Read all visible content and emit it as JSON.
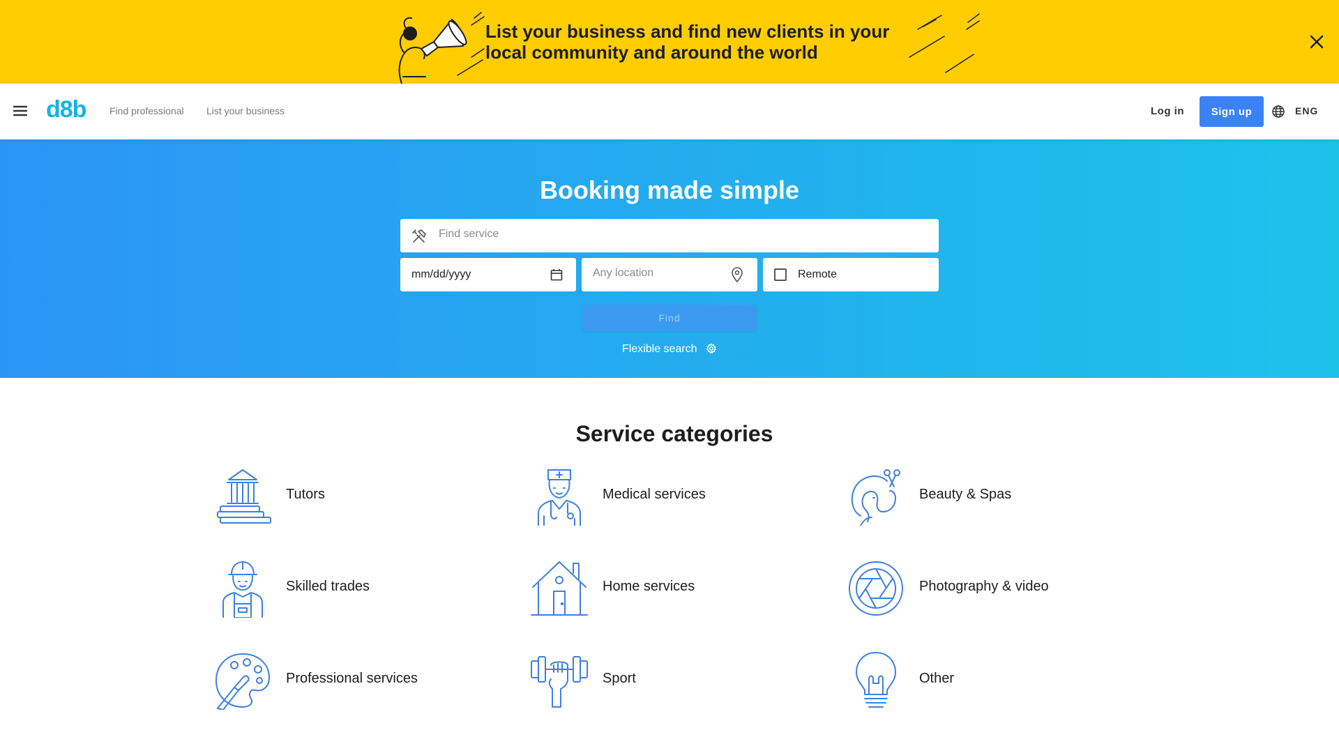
{
  "promo": {
    "text": "List your business and find new clients in your local community and around the world",
    "accent_color": "#ffcd00"
  },
  "header": {
    "logo": "d8b",
    "nav": {
      "find_professional": "Find professional",
      "list_business": "List your business"
    },
    "login": "Log in",
    "signup": "Sign up",
    "language": "ENG"
  },
  "hero": {
    "title": "Booking made simple",
    "service_placeholder": "Find service",
    "date_value": "mm/dd/yyyy",
    "location_placeholder": "Any location",
    "remote_label": "Remote",
    "find_label": "Find",
    "flexible_search": "Flexible search"
  },
  "categories": {
    "title": "Service categories",
    "items": [
      {
        "label": "Tutors",
        "icon": "library-books-icon"
      },
      {
        "label": "Medical services",
        "icon": "nurse-icon"
      },
      {
        "label": "Beauty & Spas",
        "icon": "hairdresser-icon"
      },
      {
        "label": "Skilled trades",
        "icon": "builder-icon"
      },
      {
        "label": "Home services",
        "icon": "house-icon"
      },
      {
        "label": "Photography & video",
        "icon": "camera-aperture-icon"
      },
      {
        "label": "Professional services",
        "icon": "palette-icon"
      },
      {
        "label": "Sport",
        "icon": "dumbbell-icon"
      },
      {
        "label": "Other",
        "icon": "lightbulb-icon"
      }
    ]
  },
  "colors": {
    "primary": "#3b82f6",
    "logo": "#14b4e4",
    "icon_stroke": "#3d7fe0"
  }
}
